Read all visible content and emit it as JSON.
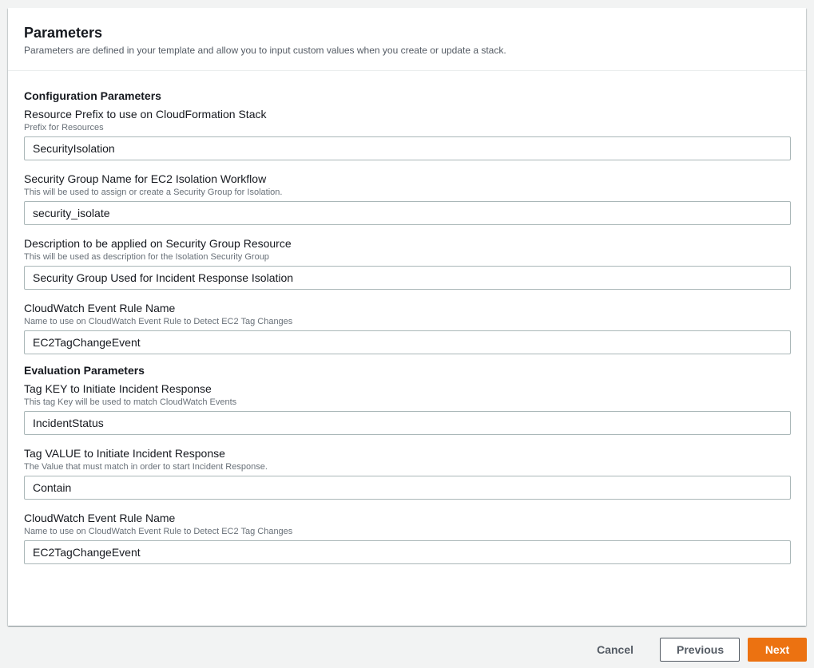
{
  "header": {
    "title": "Parameters",
    "description": "Parameters are defined in your template and allow you to input custom values when you create or update a stack."
  },
  "sections": [
    {
      "title": "Configuration Parameters",
      "fields": [
        {
          "label": "Resource Prefix to use on CloudFormation Stack",
          "hint": "Prefix for Resources",
          "value": "SecurityIsolation"
        },
        {
          "label": "Security Group Name for EC2 Isolation Workflow",
          "hint": "This will be used to assign or create a Security Group for Isolation.",
          "value": "security_isolate"
        },
        {
          "label": "Description to be applied on Security Group Resource",
          "hint": "This will be used as description for the Isolation Security Group",
          "value": "Security Group Used for Incident Response Isolation"
        },
        {
          "label": "CloudWatch Event Rule Name",
          "hint": "Name to use on CloudWatch Event Rule to Detect EC2 Tag Changes",
          "value": "EC2TagChangeEvent"
        }
      ]
    },
    {
      "title": "Evaluation Parameters",
      "fields": [
        {
          "label": "Tag KEY to Initiate Incident Response",
          "hint": "This tag Key will be used to match CloudWatch Events",
          "value": "IncidentStatus"
        },
        {
          "label": "Tag VALUE to Initiate Incident Response",
          "hint": "The Value that must match in order to start Incident Response.",
          "value": "Contain"
        },
        {
          "label": "CloudWatch Event Rule Name",
          "hint": "Name to use on CloudWatch Event Rule to Detect EC2 Tag Changes",
          "value": "EC2TagChangeEvent"
        }
      ]
    }
  ],
  "footer": {
    "cancel_label": "Cancel",
    "previous_label": "Previous",
    "next_label": "Next"
  },
  "colors": {
    "primary_button": "#ec7211",
    "page_background": "#f2f3f3",
    "input_border": "#aab7b8"
  }
}
